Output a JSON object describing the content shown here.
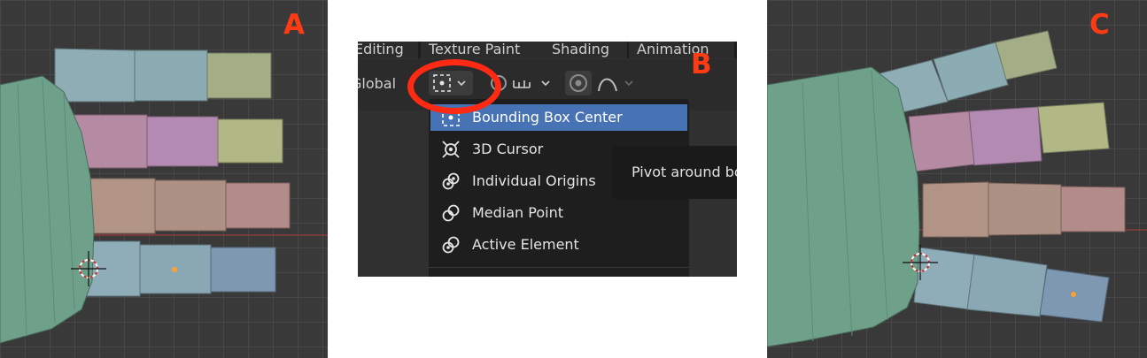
{
  "labels": {
    "a": "A",
    "b": "B",
    "c": "C"
  },
  "workspace_tabs": [
    "Editing",
    "Texture Paint",
    "Shading",
    "Animation"
  ],
  "toolbar": {
    "orientation": "Global"
  },
  "pivot_menu": {
    "items": [
      {
        "label": "Bounding Box Center",
        "icon": "bounding-box-center-icon",
        "selected": true
      },
      {
        "label": "3D Cursor",
        "icon": "3d-cursor-icon",
        "selected": false
      },
      {
        "label": "Individual Origins",
        "icon": "individual-origins-icon",
        "selected": false
      },
      {
        "label": "Median Point",
        "icon": "median-point-icon",
        "selected": false
      },
      {
        "label": "Active Element",
        "icon": "active-element-icon",
        "selected": false
      }
    ],
    "tooltip": "Pivot around bounding box center"
  },
  "colors": {
    "label_red": "#ff3b14",
    "viewport_bg": "#393939",
    "hand_green": "#6fa08a",
    "menu_highlight": "#4772b3"
  }
}
